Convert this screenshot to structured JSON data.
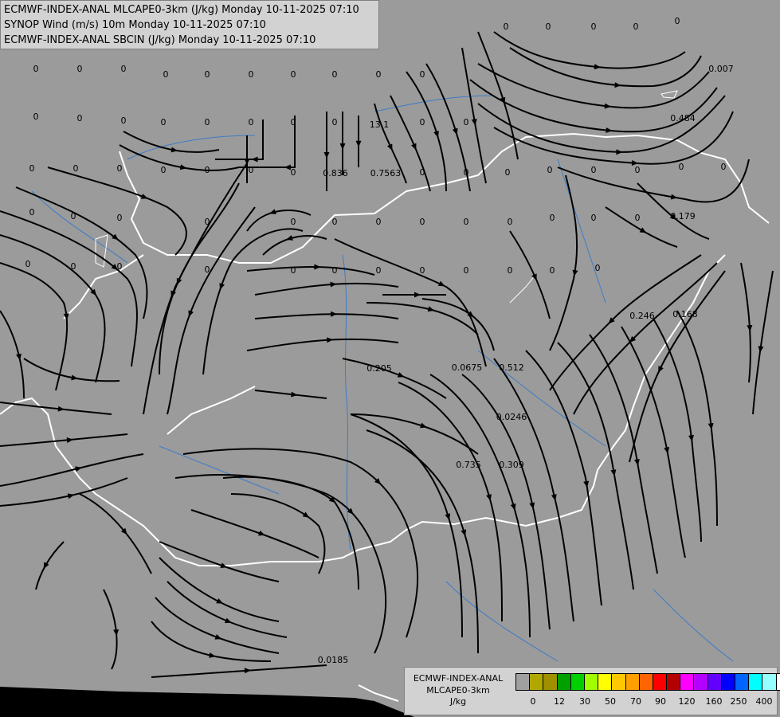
{
  "header": {
    "line1": "ECMWF-INDEX-ANAL MLCAPE0-3km (J/kg) Monday 10-11-2025 07:10",
    "line2": "SYNOP Wind (m/s) 10m Monday 10-11-2025 07:10",
    "line3": "ECMWF-INDEX-ANAL SBCIN (J/kg) Monday 10-11-2025 07:10"
  },
  "legend": {
    "title_line1": "ECMWF-INDEX-ANAL",
    "title_line2": "MLCAPE0-3km",
    "unit": "J/kg",
    "colors": [
      "#a0a0a0",
      "#b0a800",
      "#a09000",
      "#00a000",
      "#00d000",
      "#a0ff00",
      "#ffff00",
      "#ffc800",
      "#ffa000",
      "#ff6400",
      "#ff0000",
      "#b40000",
      "#ff00ff",
      "#b400ff",
      "#6400ff",
      "#0000ff",
      "#0064ff",
      "#00ffff",
      "#96ffff",
      "#ffffff"
    ],
    "ticks": [
      "0",
      "12",
      "30",
      "50",
      "70",
      "90",
      "120",
      "160",
      "250",
      "400"
    ]
  },
  "colors": {
    "background": "#9b9b9b",
    "streamline": "#000000",
    "border": "#ffffff",
    "river": "#3c7cc8",
    "sea": "#000000"
  },
  "point_values": [
    "0",
    "0",
    "0",
    "0",
    "0",
    "0",
    "0",
    "0",
    "0",
    "0",
    "0",
    "0",
    "0",
    "0",
    "0",
    "0",
    "0",
    "0",
    "0",
    "0",
    "0",
    "0",
    "0",
    "0",
    "0",
    "0",
    "0",
    "0",
    "0",
    "0",
    "0",
    "0",
    "0",
    "0",
    "0",
    "0",
    "0",
    "0",
    "0",
    "0",
    "0.007",
    "0.484",
    "0.836",
    "0.7563",
    "13.1",
    "0.179",
    "0.246",
    "0.168",
    "0.205",
    "0.0675",
    "0.512",
    "0.0246",
    "0.735",
    "0.309",
    "0.0185",
    "0",
    "0",
    "0",
    "0",
    "0",
    "0",
    "0",
    "0",
    "0",
    "0",
    "0",
    "0",
    "0",
    "0",
    "0",
    "0",
    "0",
    "0",
    "0",
    "0",
    "0",
    "0",
    "0",
    "0",
    "0"
  ]
}
